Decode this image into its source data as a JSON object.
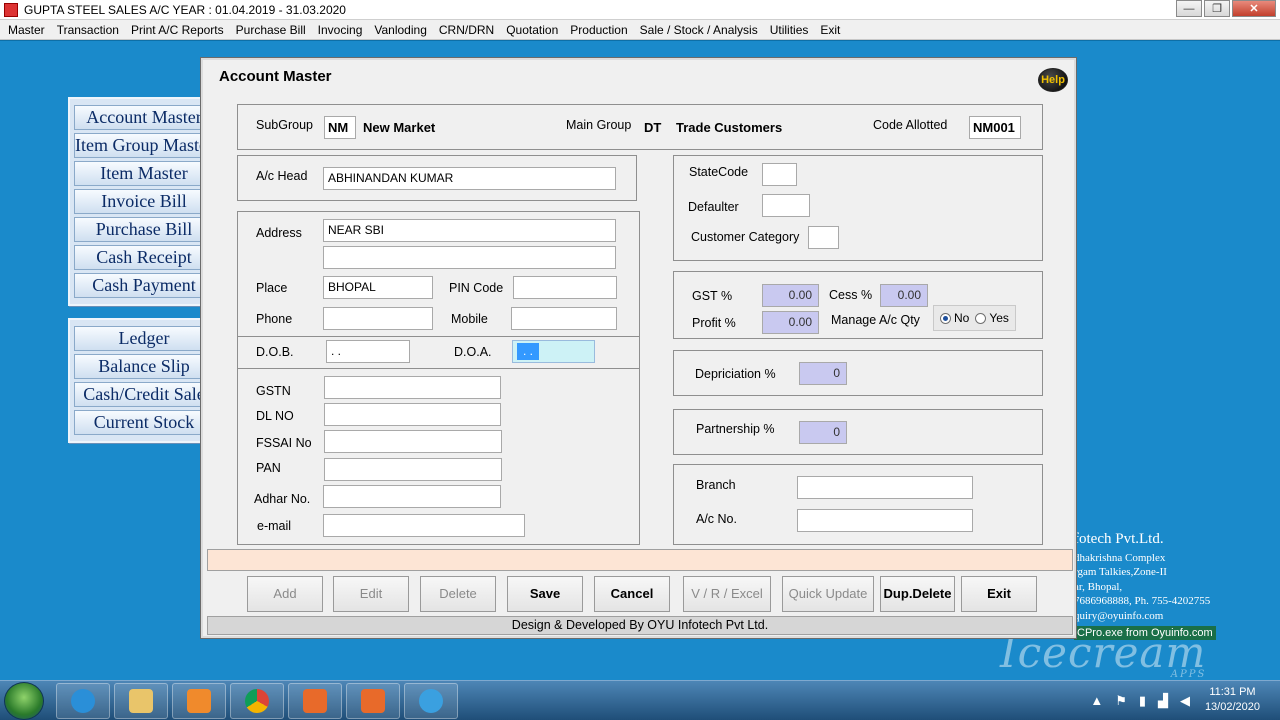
{
  "window": {
    "title": "GUPTA STEEL SALES A/C YEAR : 01.04.2019 - 31.03.2020",
    "controls": [
      "—",
      "❐",
      "✕"
    ]
  },
  "menu": [
    "Master",
    "Transaction",
    "Print A/C Reports",
    "Purchase Bill",
    "Invocing",
    "Vanloding",
    "CRN/DRN",
    "Quotation",
    "Production",
    "Sale / Stock / Analysis",
    "Utilities",
    "Exit"
  ],
  "nav_top": [
    "Account Master",
    "Item Group Master",
    "Item Master",
    "Invoice Bill",
    "Purchase Bill",
    "Cash Receipt",
    "Cash Payment"
  ],
  "nav_bottom": [
    "Ledger",
    "Balance Slip",
    "Cash/Credit Sale",
    "Current Stock"
  ],
  "company_info": {
    "name": "fotech Pvt.Ltd.",
    "lines": [
      "dhakrishna Complex",
      "rgam Talkies,Zone-II",
      "ar, Bhopal,",
      "7686968888, Ph. 755-4202755",
      "quiry@oyuinfo.com"
    ],
    "pro_line": "CPro.exe from Oyuinfo.com"
  },
  "watermark": {
    "text": "Icecream",
    "sub": "APPS"
  },
  "dialog": {
    "title": "Account Master",
    "help": "Help",
    "subgroup_label": "SubGroup",
    "subgroup_code": "NM",
    "subgroup_name": "New Market",
    "main_group_label": "Main Group",
    "main_group_code": "DT",
    "main_group_name": "Trade Customers",
    "code_allotted_label": "Code Allotted",
    "code_allotted_value": "NM001",
    "ac_head_label": "A/c Head",
    "ac_head_value": "ABHINANDAN KUMAR",
    "address_label": "Address",
    "address_line1": "NEAR SBI",
    "address_line2": "",
    "place_label": "Place",
    "place_value": "BHOPAL",
    "pin_label": "PIN Code",
    "pin_value": "",
    "phone_label": "Phone",
    "phone_value": "",
    "mobile_label": "Mobile",
    "mobile_value": "",
    "dob_label": "D.O.B.",
    "dob_value": " .  .",
    "doa_label": "D.O.A.",
    "doa_value": " .  .",
    "gstn_label": "GSTN",
    "dlno_label": "DL NO",
    "fssai_label": "FSSAI No",
    "pan_label": "PAN",
    "adhar_label": "Adhar No.",
    "email_label": "e-mail",
    "statecode_label": "StateCode",
    "defaulter_label": "Defaulter",
    "customer_category_label": "Customer Category",
    "gst_label": "GST %",
    "gst_value": "0.00",
    "cess_label": "Cess %",
    "cess_value": "0.00",
    "profit_label": "Profit %",
    "profit_value": "0.00",
    "manage_qty_label": "Manage A/c Qty",
    "manage_qty_options": [
      "No",
      "Yes"
    ],
    "manage_qty_selected": "No",
    "depriciation_label": "Depriciation %",
    "depriciation_value": "0",
    "partnership_label": "Partnership %",
    "partnership_value": "0",
    "branch_label": "Branch",
    "acno_label": "A/c No.",
    "buttons": {
      "add": "Add",
      "edit": "Edit",
      "delete": "Delete",
      "save": "Save",
      "cancel": "Cancel",
      "vr_excel": "V / R / Excel",
      "quick_update": "Quick Update",
      "dup_delete": "Dup.Delete",
      "exit": "Exit"
    },
    "footer": "Design & Developed By OYU Infotech Pvt Ltd."
  },
  "taskbar": {
    "clock_time": "11:31 PM",
    "clock_date": "13/02/2020"
  }
}
